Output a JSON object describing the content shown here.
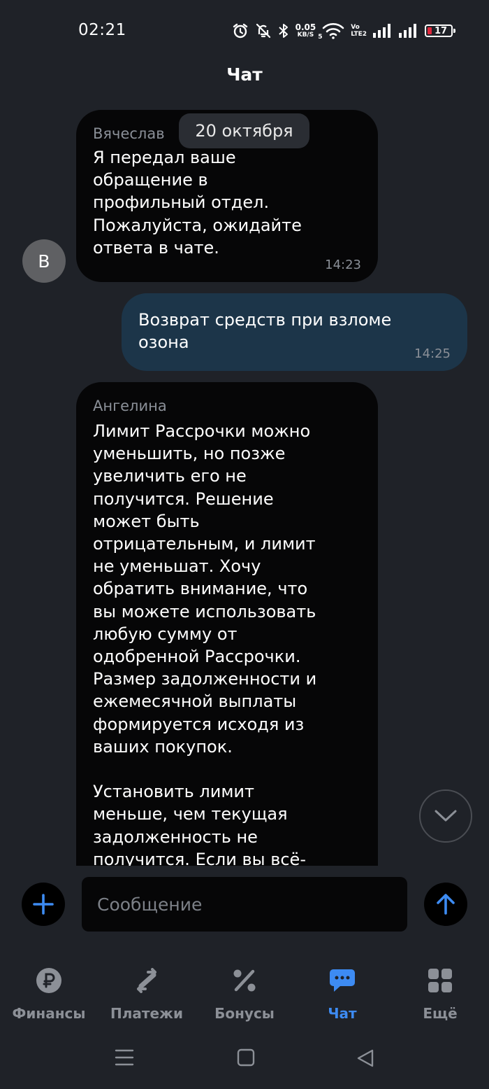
{
  "status_bar": {
    "time": "02:21",
    "net_speed": "0.05",
    "net_unit": "KB/S",
    "wifi_badge": "5",
    "volte_top": "Vo",
    "volte_bottom": "LTE2",
    "battery": "17",
    "battery_color": "#e0283c"
  },
  "header": {
    "title": "Чат"
  },
  "chat": {
    "date_chip": "20 октября",
    "messages": [
      {
        "direction": "incoming",
        "sender": "Вячеслав",
        "avatar_letter": "В",
        "lines": "Я передал ваше\nобращение в\nпрофильный отдел.\nПожалуйста, ожидайте\nответа в чате.",
        "time": "14:23"
      },
      {
        "direction": "outgoing",
        "lines": "Возврат средств при взломе\nозона",
        "time": "14:25"
      },
      {
        "direction": "incoming",
        "sender": "Ангелина",
        "lines": "Лимит Рассрочки можно\nуменьшить, но позже\nувеличить его не\nполучится. Решение\nможет быть\nотрицательным, и лимит\nне уменьшат. Хочу\nобратить внимание, что\nвы можете использовать\nлюбую сумму от\nодобренной Рассрочки.\nРазмер задолженности и\nежемесячной выплаты\nформируется исходя из\nваших покупок.\n\nУстановить лимит\nменьше, чем текущая\nзадолженность не\nполучится. Если вы всё-"
      }
    ]
  },
  "composer": {
    "placeholder": "Сообщение",
    "add_icon": "plus-icon",
    "send_icon": "arrow-up-icon"
  },
  "bottom_nav": {
    "items": [
      {
        "label": "Финансы",
        "icon": "ruble-icon",
        "active": false
      },
      {
        "label": "Платежи",
        "icon": "transfer-arrows-icon",
        "active": false
      },
      {
        "label": "Бонусы",
        "icon": "percent-icon",
        "active": false
      },
      {
        "label": "Чат",
        "icon": "chat-bubble-icon",
        "active": true
      },
      {
        "label": "Ещё",
        "icon": "grid-icon",
        "active": false
      }
    ]
  },
  "colors": {
    "background": "#1f2228",
    "incoming_bubble": "#060607",
    "outgoing_bubble": "#1c3549",
    "accent": "#3d8bf2",
    "muted_text": "#8a8f97"
  }
}
